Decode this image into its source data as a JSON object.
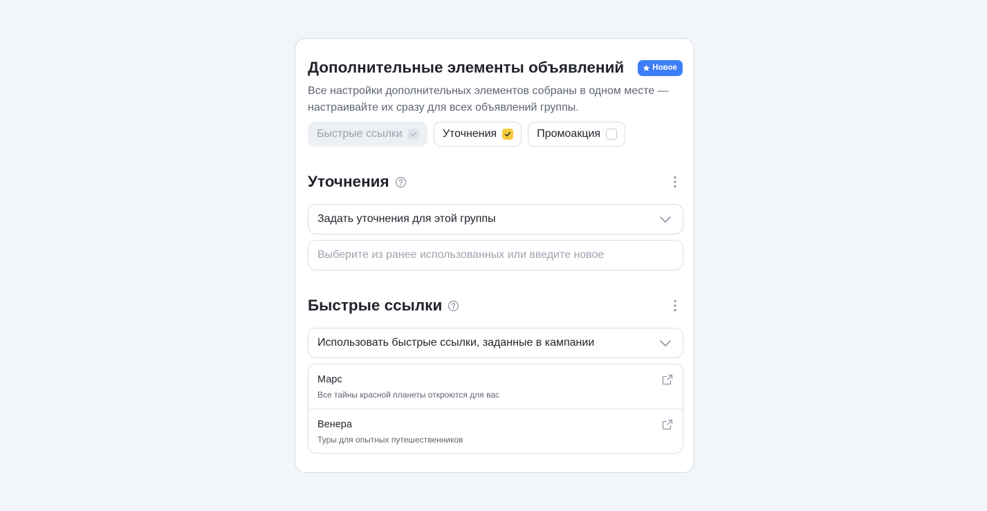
{
  "card": {
    "title": "Дополнительные элементы объявлений",
    "badge": {
      "label": "Новое",
      "icon": "star-icon",
      "color": "#3d7df5"
    },
    "description": "Все настройки дополнительных элементов собраны в одном месте — настраивайте их сразу для всех объявлений группы."
  },
  "chips": [
    {
      "label": "Быстрые ссылки",
      "checked": true,
      "disabled": true
    },
    {
      "label": "Уточнения",
      "checked": true,
      "disabled": false
    },
    {
      "label": "Промоакция",
      "checked": false,
      "disabled": false
    }
  ],
  "refinements": {
    "heading": "Уточнения",
    "help_icon": "question-circle-icon",
    "menu_icon": "kebab-menu-icon",
    "select_value": "Задать уточнения для этой группы",
    "select_icon": "chevron-down-icon",
    "input_placeholder": "Выберите из ранее использованных или введите новое"
  },
  "quick_links": {
    "heading": "Быстрые ссылки",
    "help_icon": "question-circle-icon",
    "menu_icon": "kebab-menu-icon",
    "select_value": "Использовать быстрые ссылки, заданные в кампании",
    "select_icon": "chevron-down-icon",
    "items": [
      {
        "title": "Марс",
        "description": "Все тайны красной планеты откроются для вас",
        "icon": "external-link-icon"
      },
      {
        "title": "Венера",
        "description": "Туры для опытных путешественников",
        "icon": "external-link-icon"
      }
    ]
  },
  "colors": {
    "page_background": "#f2f5f9",
    "accent": "#3d7df5",
    "checkbox_checked": "#f7cb3d",
    "text": "#21242c",
    "muted_text": "#5e6472",
    "placeholder": "#9ca3af"
  }
}
